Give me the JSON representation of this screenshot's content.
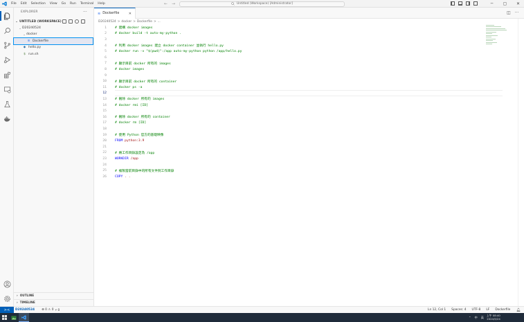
{
  "window": {
    "title": "Untitled (Workspace) [Administrator]",
    "controls": [
      "─",
      "▢",
      "✕"
    ]
  },
  "menu": [
    "File",
    "Edit",
    "Selection",
    "View",
    "Go",
    "Run",
    "Terminal",
    "Help"
  ],
  "sidebar": {
    "header": "EXPLORER",
    "workspace": "UNTITLED (WORKSPACE)",
    "tree": [
      {
        "label": "D20240524",
        "depth": 1,
        "type": "folder",
        "expanded": true
      },
      {
        "label": "docker",
        "depth": 2,
        "type": "folder",
        "expanded": true
      },
      {
        "label": "Dockerfile",
        "depth": 3,
        "type": "docker",
        "selected": true
      },
      {
        "label": "hello.py",
        "depth": 2,
        "type": "python"
      },
      {
        "label": "run.sh",
        "depth": 2,
        "type": "shell"
      }
    ],
    "bottom_sections": [
      "OUTLINE",
      "TIMELINE"
    ]
  },
  "editor": {
    "tab_label": "Dockerfile",
    "breadcrumb": [
      "D20240524",
      ">",
      "docker",
      ">",
      "Dockerfile",
      ">",
      "..."
    ],
    "current_line": 12,
    "lines": [
      {
        "n": "1",
        "parts": [
          {
            "c": "cm",
            "t": "# 建構 docker images"
          }
        ]
      },
      {
        "n": "2",
        "parts": [
          {
            "c": "cm",
            "t": "# docker build -t auto-my-python ."
          }
        ]
      },
      {
        "n": "3",
        "parts": []
      },
      {
        "n": "4",
        "parts": [
          {
            "c": "cm",
            "t": "# 利用 docker images 建立 docker container 並執行 hello.py"
          }
        ]
      },
      {
        "n": "5",
        "parts": [
          {
            "c": "cm",
            "t": "# docker run -v \"$(pwd)\":/app auto-my-python python /app/hello.py"
          }
        ]
      },
      {
        "n": "6",
        "parts": []
      },
      {
        "n": "7",
        "parts": [
          {
            "c": "cm",
            "t": "# 顯示目前 docker 所有的 images"
          }
        ]
      },
      {
        "n": "8",
        "parts": [
          {
            "c": "cm",
            "t": "# docker images"
          }
        ]
      },
      {
        "n": "9",
        "parts": []
      },
      {
        "n": "10",
        "parts": [
          {
            "c": "cm",
            "t": "# 顯示目前 docker 所有的 container"
          }
        ]
      },
      {
        "n": "11",
        "parts": [
          {
            "c": "cm",
            "t": "# docker ps -a"
          }
        ]
      },
      {
        "n": "12",
        "parts": []
      },
      {
        "n": "13",
        "parts": [
          {
            "c": "cm",
            "t": "# 刪除 docker 所有的 images"
          }
        ]
      },
      {
        "n": "14",
        "parts": [
          {
            "c": "cm",
            "t": "# docker rmi [ID]"
          }
        ]
      },
      {
        "n": "15",
        "parts": []
      },
      {
        "n": "16",
        "parts": [
          {
            "c": "cm",
            "t": "# 刪除 docker 所有的 container"
          }
        ]
      },
      {
        "n": "17",
        "parts": [
          {
            "c": "cm",
            "t": "# docker rm [ID]"
          }
        ]
      },
      {
        "n": "18",
        "parts": []
      },
      {
        "n": "19",
        "parts": [
          {
            "c": "cm",
            "t": "# 使用 Python 官方的基礎映像"
          }
        ]
      },
      {
        "n": "20",
        "parts": [
          {
            "c": "kw",
            "t": "FROM"
          },
          {
            "c": "tx",
            "t": " python:3.9"
          }
        ]
      },
      {
        "n": "21",
        "parts": []
      },
      {
        "n": "22",
        "parts": [
          {
            "c": "cm",
            "t": "# 將工作目錄設定為 /app"
          }
        ]
      },
      {
        "n": "23",
        "parts": [
          {
            "c": "kw",
            "t": "WORKDIR"
          },
          {
            "c": "tx",
            "t": " /app"
          }
        ]
      },
      {
        "n": "24",
        "parts": []
      },
      {
        "n": "25",
        "parts": [
          {
            "c": "cm",
            "t": "# 複製當前目錄中的所有文件到工作目錄"
          }
        ]
      },
      {
        "n": "26",
        "parts": [
          {
            "c": "kw",
            "t": "COPY"
          },
          {
            "c": "tx",
            "t": " . ."
          }
        ]
      }
    ]
  },
  "status": {
    "remote": "><",
    "workspace": "D20240524",
    "problems": "⊗ 0 ⚠ 0",
    "ports": "⑂ 0",
    "right": [
      "Ln 12, Col 1",
      "Spaces: 4",
      "UTF-8",
      "LF",
      "Dockerfile"
    ]
  },
  "taskbar": {
    "tray": [
      "⌃",
      "中",
      "英"
    ],
    "time": "上午 08:40",
    "date": "2024/5/24"
  }
}
